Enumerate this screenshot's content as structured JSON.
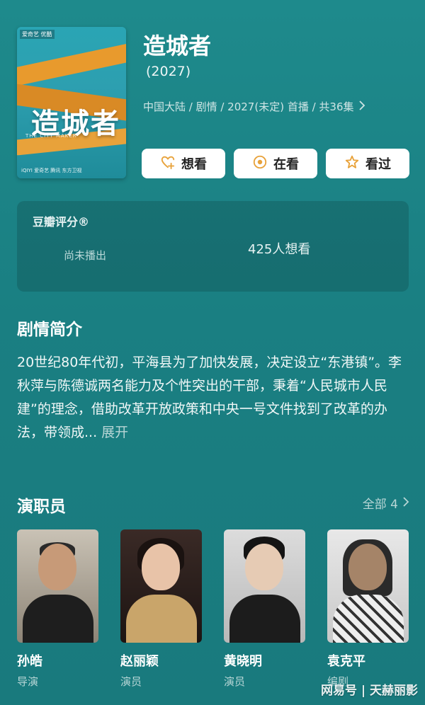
{
  "poster": {
    "title": "造城者",
    "subtitle": "THE CITY MAKER",
    "corner_label": "爱奇艺 优酷",
    "footer": "iQIYI 爱奇艺  腾讯  东方卫视"
  },
  "header": {
    "title": "造城者",
    "year": "(2027)",
    "meta": "中国大陆 / 剧情 / 2027(未定) 首播 / 共36集",
    "meta_chevron_icon": "chevron-right-icon"
  },
  "actions": [
    {
      "label": "想看",
      "icon": "heart-plus-icon"
    },
    {
      "label": "在看",
      "icon": "circle-dot-icon"
    },
    {
      "label": "看过",
      "icon": "star-icon"
    }
  ],
  "rating": {
    "label": "豆瓣评分®",
    "status": "尚未播出",
    "want_count": "425人想看"
  },
  "synopsis": {
    "heading": "剧情简介",
    "text": "20世纪80年代初，平海县为了加快发展，决定设立“东港镇”。李秋萍与陈德诚两名能力及个性突出的干部，秉着“人民城市人民建”的理念，借助改革开放政策和中央一号文件找到了改革的办法，带领成...",
    "expand_label": "展开"
  },
  "cast": {
    "heading": "演职员",
    "all_label": "全部 4",
    "members": [
      {
        "name": "孙皓",
        "role": "导演"
      },
      {
        "name": "赵丽颖",
        "role": "演员"
      },
      {
        "name": "黄晓明",
        "role": "演员"
      },
      {
        "name": "袁克平",
        "role": "编剧"
      }
    ]
  },
  "watermark": "网易号 | 天赫丽影",
  "colors": {
    "background": "#1b8386",
    "button_bg": "#ffffff",
    "accent_icon": "#e8a23a"
  }
}
